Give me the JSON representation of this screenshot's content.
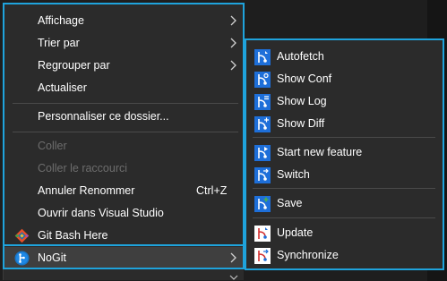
{
  "colors": {
    "background": "#1e1e1e",
    "menu_bg": "#2b2b2b",
    "highlight_frame": "#1fa3dc",
    "disabled_text": "#6d6d6d",
    "separator": "#4a4a4a",
    "text": "#ffffff"
  },
  "main_menu": {
    "items": [
      {
        "label": "Affichage",
        "submenu": true,
        "icon": "",
        "enabled": true
      },
      {
        "label": "Trier par",
        "submenu": true,
        "icon": "",
        "enabled": true
      },
      {
        "label": "Regrouper par",
        "submenu": true,
        "icon": "",
        "enabled": true
      },
      {
        "label": "Actualiser",
        "submenu": false,
        "icon": "",
        "enabled": true
      },
      {
        "label": "Personnaliser ce dossier...",
        "submenu": false,
        "icon": "",
        "enabled": true
      },
      {
        "label": "Coller",
        "submenu": false,
        "icon": "",
        "enabled": false
      },
      {
        "label": "Coller le raccourci",
        "submenu": false,
        "icon": "",
        "enabled": false
      },
      {
        "label": "Annuler Renommer",
        "shortcut": "Ctrl+Z",
        "submenu": false,
        "icon": "",
        "enabled": true
      },
      {
        "label": "Ouvrir dans Visual Studio",
        "submenu": false,
        "icon": "",
        "enabled": true
      },
      {
        "label": "Git Bash Here",
        "submenu": false,
        "icon": "git-bash-icon",
        "enabled": true
      },
      {
        "label": "NoGit",
        "submenu": true,
        "icon": "nogit-icon",
        "enabled": true,
        "hover": true
      }
    ]
  },
  "nogit_submenu": {
    "items": [
      {
        "label": "Autofetch",
        "icon": "gitflow-fetch-icon"
      },
      {
        "label": "Show Conf",
        "icon": "gitflow-conf-icon"
      },
      {
        "label": "Show Log",
        "icon": "gitflow-log-icon"
      },
      {
        "label": "Show Diff",
        "icon": "gitflow-diff-icon"
      },
      {
        "label": "Start new feature",
        "icon": "gitflow-feature-icon"
      },
      {
        "label": "Switch",
        "icon": "gitflow-switch-icon"
      },
      {
        "label": "Save",
        "icon": "gitflow-save-icon"
      },
      {
        "label": "Update",
        "icon": "gitflow-update-icon"
      },
      {
        "label": "Synchronize",
        "icon": "gitflow-sync-icon"
      }
    ]
  }
}
